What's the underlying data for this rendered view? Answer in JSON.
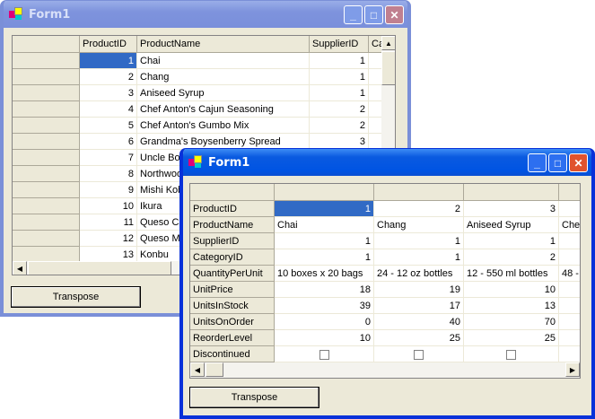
{
  "back": {
    "title": "Form1",
    "columns": [
      "ProductID",
      "ProductName",
      "SupplierID",
      "Ca"
    ],
    "rows": [
      [
        "1",
        "Chai",
        "1"
      ],
      [
        "2",
        "Chang",
        "1"
      ],
      [
        "3",
        "Aniseed Syrup",
        "1"
      ],
      [
        "4",
        "Chef Anton's Cajun Seasoning",
        "2"
      ],
      [
        "5",
        "Chef Anton's Gumbo Mix",
        "2"
      ],
      [
        "6",
        "Grandma's Boysenberry Spread",
        "3"
      ],
      [
        "7",
        "Uncle Bo",
        ""
      ],
      [
        "8",
        "Northwoo",
        ""
      ],
      [
        "9",
        "Mishi Kob",
        ""
      ],
      [
        "10",
        "Ikura",
        ""
      ],
      [
        "11",
        "Queso Ca",
        ""
      ],
      [
        "12",
        "Queso M",
        ""
      ],
      [
        "13",
        "Konbu",
        ""
      ]
    ],
    "button": "Transpose"
  },
  "front": {
    "title": "Form1",
    "row_headers": [
      "ProductID",
      "ProductName",
      "SupplierID",
      "CategoryID",
      "QuantityPerUnit",
      "UnitPrice",
      "UnitsInStock",
      "UnitsOnOrder",
      "ReorderLevel",
      "Discontinued"
    ],
    "cols": [
      [
        "1",
        "Chai",
        "1",
        "1",
        "10 boxes x 20 bags",
        "18",
        "39",
        "0",
        "10",
        false
      ],
      [
        "2",
        "Chang",
        "1",
        "1",
        "24 - 12 oz bottles",
        "19",
        "17",
        "40",
        "25",
        false
      ],
      [
        "3",
        "Aniseed Syrup",
        "1",
        "2",
        "12 - 550 ml bottles",
        "10",
        "13",
        "70",
        "25",
        false
      ],
      [
        "",
        "Che",
        "",
        "",
        "48 -",
        "",
        "",
        "",
        "",
        false
      ]
    ],
    "button": "Transpose"
  }
}
